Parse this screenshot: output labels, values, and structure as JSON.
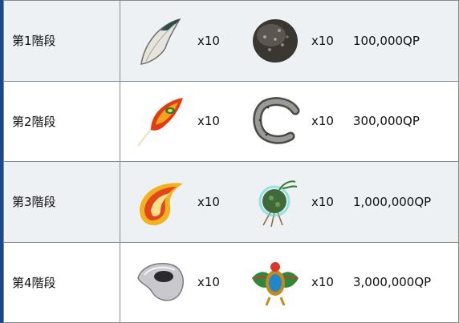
{
  "rows": [
    {
      "step": "第1階段",
      "item1": "feather-claw-icon",
      "count1": "x10",
      "item2": "rock-ball-icon",
      "count2": "x10",
      "qp": "100,000QP"
    },
    {
      "step": "第2階段",
      "item1": "phoenix-feather-icon",
      "count1": "x10",
      "item2": "horseshoe-icon",
      "count2": "x10",
      "qp": "300,000QP"
    },
    {
      "step": "第3階段",
      "item1": "flame-plume-icon",
      "count1": "x10",
      "item2": "moss-ball-icon",
      "count2": "x10",
      "qp": "1,000,000QP"
    },
    {
      "step": "第4階段",
      "item1": "grey-gem-icon",
      "count1": "x10",
      "item2": "scarab-icon",
      "count2": "x10",
      "qp": "3,000,000QP"
    }
  ],
  "colors": {
    "border": "#8a8a8a",
    "shade": "#eef1f4",
    "left_strip": "#1a4a8a"
  }
}
